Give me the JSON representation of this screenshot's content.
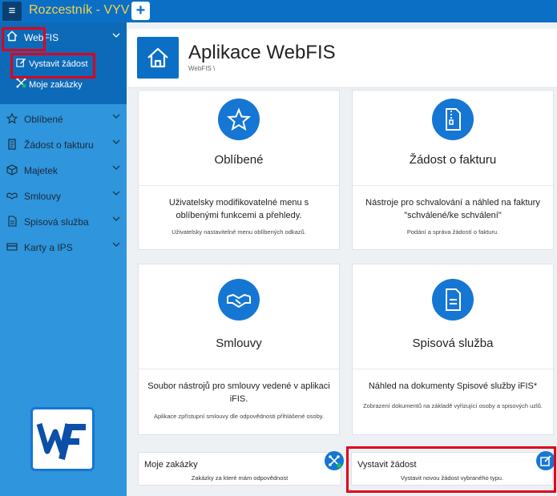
{
  "topbar": {
    "menu_icon": "hamburger-icon",
    "title": "Rozcestník - VYV",
    "add_icon": "plus-icon"
  },
  "sidebar": {
    "open_group": {
      "label": "WebFIS",
      "icon": "home-icon",
      "children": [
        {
          "label": "Vystavit žádost",
          "icon": "edit-icon"
        },
        {
          "label": "Moje zakázky",
          "icon": "network-icon"
        }
      ]
    },
    "items": [
      {
        "label": "Oblíbené",
        "icon": "star-icon"
      },
      {
        "label": "Žádost o fakturu",
        "icon": "invoice-icon"
      },
      {
        "label": "Majetek",
        "icon": "box-icon"
      },
      {
        "label": "Smlouvy",
        "icon": "handshake-icon"
      },
      {
        "label": "Spisová služba",
        "icon": "document-icon"
      },
      {
        "label": "Karty a IPS",
        "icon": "card-icon"
      }
    ]
  },
  "header": {
    "title": "Aplikace WebFIS",
    "breadcrumb": "WebFIS \\"
  },
  "cards": [
    {
      "title": "Oblíbené",
      "icon": "star-icon",
      "desc": "Uživatelsky modifikovatelné menu s oblíbenými funkcemi a přehledy.",
      "sub": "Uživatelsky nastavitelné menu oblíbených odkazů."
    },
    {
      "title": "Žádost o fakturu",
      "icon": "zip-file-icon",
      "desc": "Nástroje pro schvalování a náhled na faktury \"schválené/ke schválení\"",
      "sub": "Podání a správa žádostí o fakturu."
    },
    {
      "title": "Smlouvy",
      "icon": "handshake-icon",
      "desc": "Soubor nástrojů pro smlouvy vedené v aplikaci iFIS.",
      "sub": "Aplikace zpřístupní smlouvy dle odpovědnosti přihlášené osoby."
    },
    {
      "title": "Spisová služba",
      "icon": "document-icon",
      "desc": "Náhled na dokumenty Spisové služby iFIS*",
      "sub": "Zobrazení dokumentů na základě vyřizující osoby a spisových uzlů."
    }
  ],
  "mini_cards": [
    {
      "title": "Moje zakázky",
      "sub": "Zakázky za které mám odpovědnost",
      "icon": "network-icon"
    },
    {
      "title": "Vystavit žádost",
      "sub": "Vystavit novou žádost vybraného typu.",
      "icon": "edit-icon"
    }
  ],
  "colors": {
    "primary": "#0b6fc6",
    "sidebar": "#2f95dc",
    "title_accent": "#f3d443",
    "highlight": "#e0001b"
  }
}
